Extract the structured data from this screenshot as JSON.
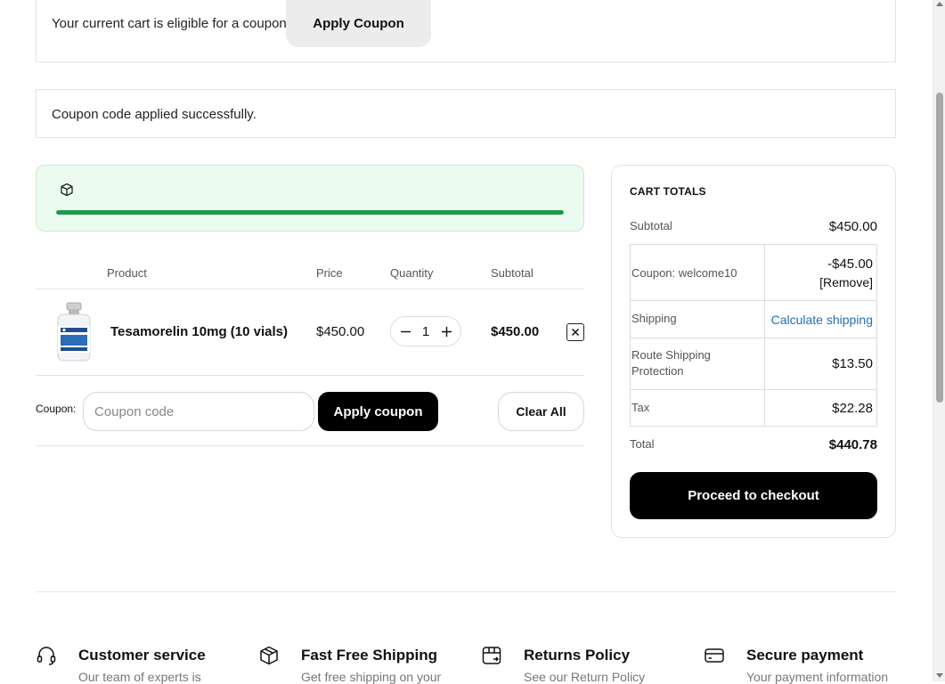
{
  "notices": {
    "coupon_eligible": "Your current cart is eligible for a coupon.",
    "apply_coupon_label": "Apply Coupon",
    "coupon_applied": "Coupon code applied successfully."
  },
  "shipping_progress": {
    "fraction": 1.0,
    "bar_color": "#1e9a44",
    "icon": "box-icon"
  },
  "cart_table": {
    "headers": {
      "product": "Product",
      "price": "Price",
      "quantity": "Quantity",
      "subtotal": "Subtotal"
    },
    "items": [
      {
        "name": "Tesamorelin 10mg (10 vials)",
        "price": "$450.00",
        "quantity": "1",
        "subtotal": "$450.00"
      }
    ]
  },
  "coupon_form": {
    "label": "Coupon:",
    "placeholder": "Coupon code",
    "value": "",
    "apply_label": "Apply coupon",
    "clear_label": "Clear All"
  },
  "totals": {
    "title": "CART TOTALS",
    "subtotal_label": "Subtotal",
    "subtotal_value": "$450.00",
    "coupon_label": "Coupon: welcome10",
    "coupon_value": "-$45.00",
    "coupon_remove": "[Remove]",
    "shipping_label": "Shipping",
    "shipping_link": "Calculate shipping",
    "route_label": "Route Shipping Protection",
    "route_value": "$13.50",
    "tax_label": "Tax",
    "tax_value": "$22.28",
    "total_label": "Total",
    "total_value": "$440.78",
    "checkout_label": "Proceed to checkout"
  },
  "features": [
    {
      "icon": "headset-icon",
      "title": "Customer service",
      "desc": "Our team of experts is"
    },
    {
      "icon": "box-icon",
      "title": "Fast Free Shipping",
      "desc": "Get free shipping on your"
    },
    {
      "icon": "return-box-icon",
      "title": "Returns Policy",
      "desc": "See our Return Policy"
    },
    {
      "icon": "credit-card-icon",
      "title": "Secure payment",
      "desc": "Your payment information"
    }
  ],
  "colors": {
    "accent": "#000000",
    "link": "#1f6fb5",
    "success_bg": "#ebfbf0",
    "success_bar": "#1e9a44"
  }
}
